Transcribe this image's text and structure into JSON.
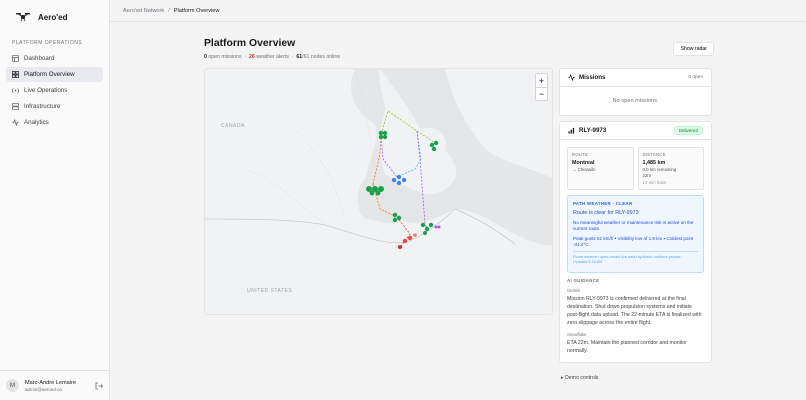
{
  "app": {
    "name": "Aero'ed"
  },
  "sidebar": {
    "heading": "PLATFORM OPERATIONS",
    "items": [
      {
        "label": "Dashboard",
        "icon": "dashboard-icon"
      },
      {
        "label": "Platform Overview",
        "icon": "overview-icon"
      },
      {
        "label": "Live Operations",
        "icon": "radio-icon"
      },
      {
        "label": "Infrastructure",
        "icon": "server-icon"
      },
      {
        "label": "Analytics",
        "icon": "activity-icon"
      }
    ],
    "user": {
      "initial": "M",
      "name": "Marc-Andre Lemaire",
      "email": "admin@aeroed.ca"
    }
  },
  "breadcrumb": {
    "root": "Aero'ed Network",
    "sep": "/",
    "current": "Platform Overview"
  },
  "page": {
    "title": "Platform Overview",
    "open_missions_count": "0",
    "open_missions_label": "open missions",
    "weather_alerts_count": "26",
    "weather_alerts_label": "weather alerts",
    "nodes_online": "61",
    "nodes_total": "61",
    "nodes_label": "nodes online",
    "show_radar": "Show radar"
  },
  "map": {
    "labels": {
      "canada": "CANADA",
      "usa": "UNITED STATES"
    },
    "zoom_in": "+",
    "zoom_out": "−"
  },
  "missions": {
    "title": "Missions",
    "count": "0 open",
    "empty": "No open missions."
  },
  "route_card": {
    "title": "RLY-9973",
    "status": "Delivered",
    "route_label": "ROUTE",
    "route_from": "Montreal",
    "route_to": "→ Chisasibi",
    "distance_label": "DISTANCE",
    "distance_value": "1,485 km",
    "remaining": "0.0 km remaining",
    "eta": "22m",
    "hubs": "12 min base"
  },
  "weather": {
    "title": "PATH WEATHER · CLEAR",
    "main": "Route is clear for RLY-9973",
    "text1": "No meaningful weather or maintenance risk is active on the current route.",
    "text2": "Peak gusts 61 km/h • Visibility low of 1.9 km • Coldest point -31.4°C",
    "foot": "Route weather: open-meteo live-data+synthetic northern probes · Updated 8:15 AM"
  },
  "guidance": {
    "heading": "AI GUIDANCE",
    "g1_label": "Gemini",
    "g1_text": "Mission RLY-9973 is confirmed delivered at the final destination. Shut down propulsion systems and initiate post-flight data upload. The 22-minute ETA is finalized with zero slippage across the entire flight.",
    "g2_label": "Snowflake",
    "g2_text": "ETA 22m. Maintain the planned corridor and monitor normally."
  },
  "demo_controls": "▸ Demo controls",
  "colors": {
    "accent": "#2563eb",
    "alert": "#dc2626",
    "success": "#15803d",
    "node": "#16a34a"
  }
}
